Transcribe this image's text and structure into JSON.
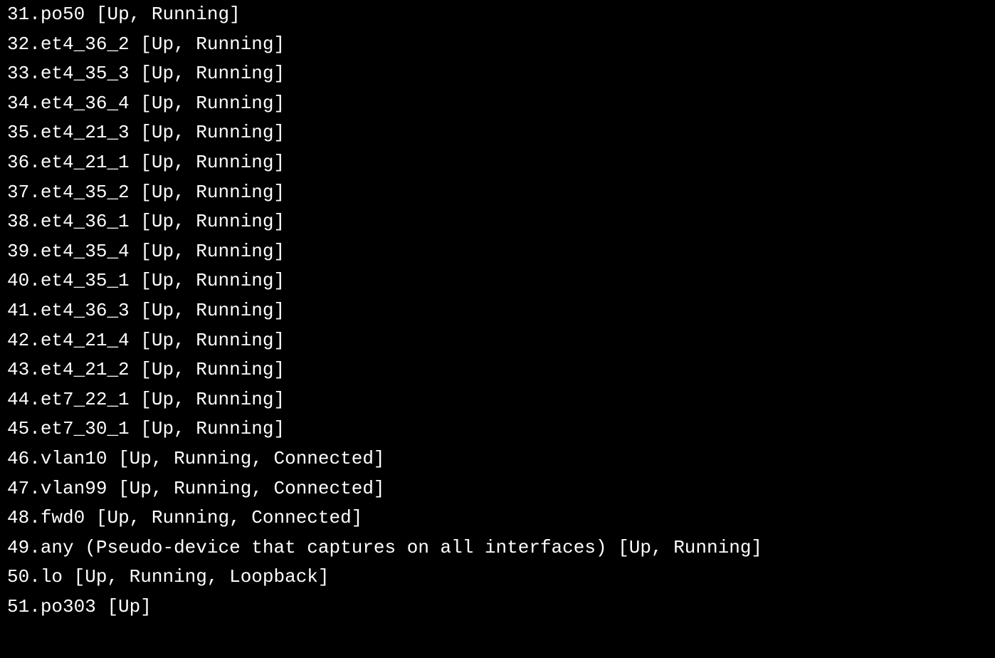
{
  "lines": [
    {
      "idx": "31",
      "name": "po50",
      "desc": "",
      "status": "[Up, Running]"
    },
    {
      "idx": "32",
      "name": "et4_36_2",
      "desc": "",
      "status": "[Up, Running]"
    },
    {
      "idx": "33",
      "name": "et4_35_3",
      "desc": "",
      "status": "[Up, Running]"
    },
    {
      "idx": "34",
      "name": "et4_36_4",
      "desc": "",
      "status": "[Up, Running]"
    },
    {
      "idx": "35",
      "name": "et4_21_3",
      "desc": "",
      "status": "[Up, Running]"
    },
    {
      "idx": "36",
      "name": "et4_21_1",
      "desc": "",
      "status": "[Up, Running]"
    },
    {
      "idx": "37",
      "name": "et4_35_2",
      "desc": "",
      "status": "[Up, Running]"
    },
    {
      "idx": "38",
      "name": "et4_36_1",
      "desc": "",
      "status": "[Up, Running]"
    },
    {
      "idx": "39",
      "name": "et4_35_4",
      "desc": "",
      "status": "[Up, Running]"
    },
    {
      "idx": "40",
      "name": "et4_35_1",
      "desc": "",
      "status": "[Up, Running]"
    },
    {
      "idx": "41",
      "name": "et4_36_3",
      "desc": "",
      "status": "[Up, Running]"
    },
    {
      "idx": "42",
      "name": "et4_21_4",
      "desc": "",
      "status": "[Up, Running]"
    },
    {
      "idx": "43",
      "name": "et4_21_2",
      "desc": "",
      "status": "[Up, Running]"
    },
    {
      "idx": "44",
      "name": "et7_22_1",
      "desc": "",
      "status": "[Up, Running]"
    },
    {
      "idx": "45",
      "name": "et7_30_1",
      "desc": "",
      "status": "[Up, Running]"
    },
    {
      "idx": "46",
      "name": "vlan10",
      "desc": "",
      "status": "[Up, Running, Connected]"
    },
    {
      "idx": "47",
      "name": "vlan99",
      "desc": "",
      "status": "[Up, Running, Connected]"
    },
    {
      "idx": "48",
      "name": "fwd0",
      "desc": "",
      "status": "[Up, Running, Connected]"
    },
    {
      "idx": "49",
      "name": "any",
      "desc": "(Pseudo-device that captures on all interfaces)",
      "status": "[Up, Running]"
    },
    {
      "idx": "50",
      "name": "lo",
      "desc": "",
      "status": "[Up, Running, Loopback]"
    },
    {
      "idx": "51",
      "name": "po303",
      "desc": "",
      "status": "[Up]"
    }
  ]
}
